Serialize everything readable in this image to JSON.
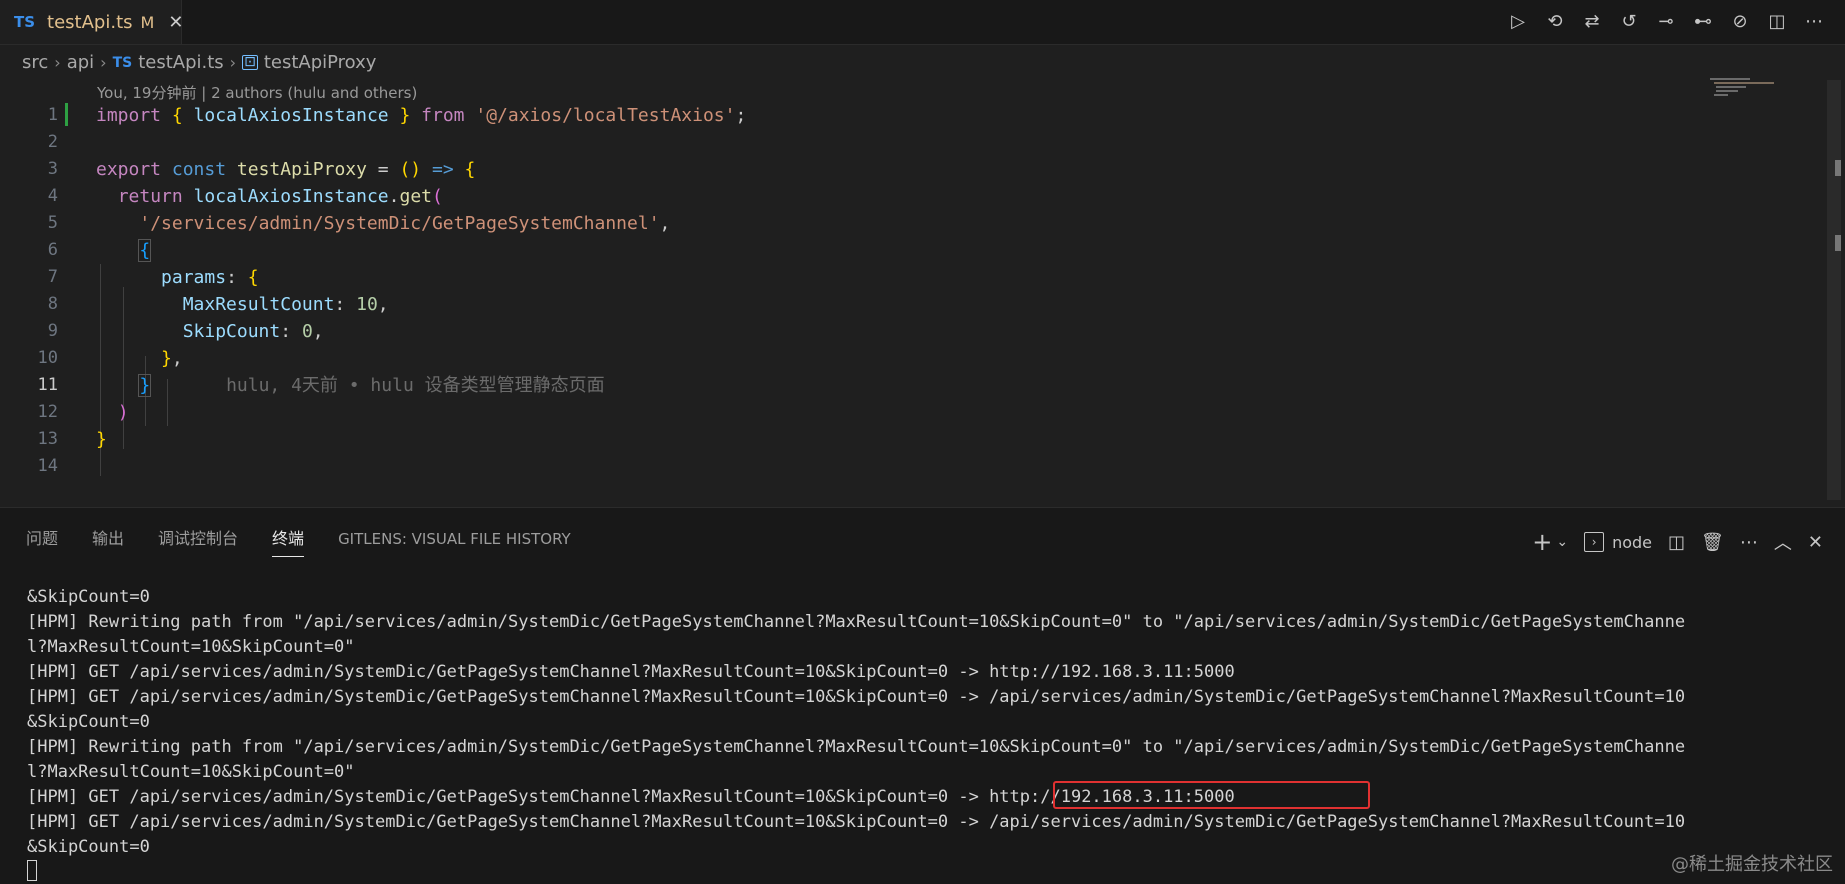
{
  "tab": {
    "lang": "TS",
    "filename": "testApi.ts",
    "modified": "M",
    "close": "✕"
  },
  "toolbar": [
    {
      "name": "run-icon",
      "glyph": "▷"
    },
    {
      "name": "history-icon",
      "glyph": "⟲"
    },
    {
      "name": "compare-changes-icon",
      "glyph": "⇄"
    },
    {
      "name": "open-changes-icon",
      "glyph": "↺"
    },
    {
      "name": "previous-change-icon",
      "glyph": "⊸"
    },
    {
      "name": "next-change-icon",
      "glyph": "⊷"
    },
    {
      "name": "gitlens-icon",
      "glyph": "⊘"
    },
    {
      "name": "split-editor-icon",
      "glyph": "◫"
    },
    {
      "name": "more-actions-icon",
      "glyph": "⋯"
    }
  ],
  "breadcrumb": {
    "p1": "src",
    "p2": "api",
    "lang": "TS",
    "file": "testApi.ts",
    "symbol": "testApiProxy"
  },
  "codelens": "You, 19分钟前 | 2 authors (hulu and others)",
  "editor": {
    "line_numbers": [
      "1",
      "2",
      "3",
      "4",
      "5",
      "6",
      "7",
      "8",
      "9",
      "10",
      "11",
      "12",
      "13",
      "14"
    ],
    "import_kw": "import",
    "import_name": "localAxiosInstance",
    "from_kw": "from",
    "import_path": "'@/axios/localTestAxios'",
    "export_kw": "export",
    "const_kw": "const",
    "fn_name": "testApiProxy",
    "return_kw": "return",
    "get_fn": "get",
    "url": "'/services/admin/SystemDic/GetPageSystemChannel'",
    "params_key": "params",
    "max_key": "MaxResultCount",
    "max_val": "10",
    "skip_key": "SkipCount",
    "skip_val": "0",
    "blame": "hulu, 4天前 • hulu 设备类型管理静态页面"
  },
  "panel": {
    "tabs": [
      "问题",
      "输出",
      "调试控制台",
      "终端",
      "GITLENS: VISUAL FILE HISTORY"
    ],
    "active_tab": "终端",
    "terminal_name": "node",
    "terminal_lines": [
      "&SkipCount=0",
      "[HPM] Rewriting path from \"/api/services/admin/SystemDic/GetPageSystemChannel?MaxResultCount=10&SkipCount=0\" to \"/api/services/admin/SystemDic/GetPageSystemChanne",
      "l?MaxResultCount=10&SkipCount=0\"",
      "[HPM] GET /api/services/admin/SystemDic/GetPageSystemChannel?MaxResultCount=10&SkipCount=0 -> http://192.168.3.11:5000",
      "[HPM] GET /api/services/admin/SystemDic/GetPageSystemChannel?MaxResultCount=10&SkipCount=0 -> /api/services/admin/SystemDic/GetPageSystemChannel?MaxResultCount=10",
      "&SkipCount=0",
      "[HPM] Rewriting path from \"/api/services/admin/SystemDic/GetPageSystemChannel?MaxResultCount=10&SkipCount=0\" to \"/api/services/admin/SystemDic/GetPageSystemChanne",
      "l?MaxResultCount=10&SkipCount=0\"",
      "[HPM] GET /api/services/admin/SystemDic/GetPageSystemChannel?MaxResultCount=10&SkipCount=0 -> http://192.168.3.11:5000",
      "[HPM] GET /api/services/admin/SystemDic/GetPageSystemChannel?MaxResultCount=10&SkipCount=0 -> /api/services/admin/SystemDic/GetPageSystemChannel?MaxResultCount=10",
      "&SkipCount=0"
    ]
  },
  "watermark": "@稀土掘金技术社区"
}
